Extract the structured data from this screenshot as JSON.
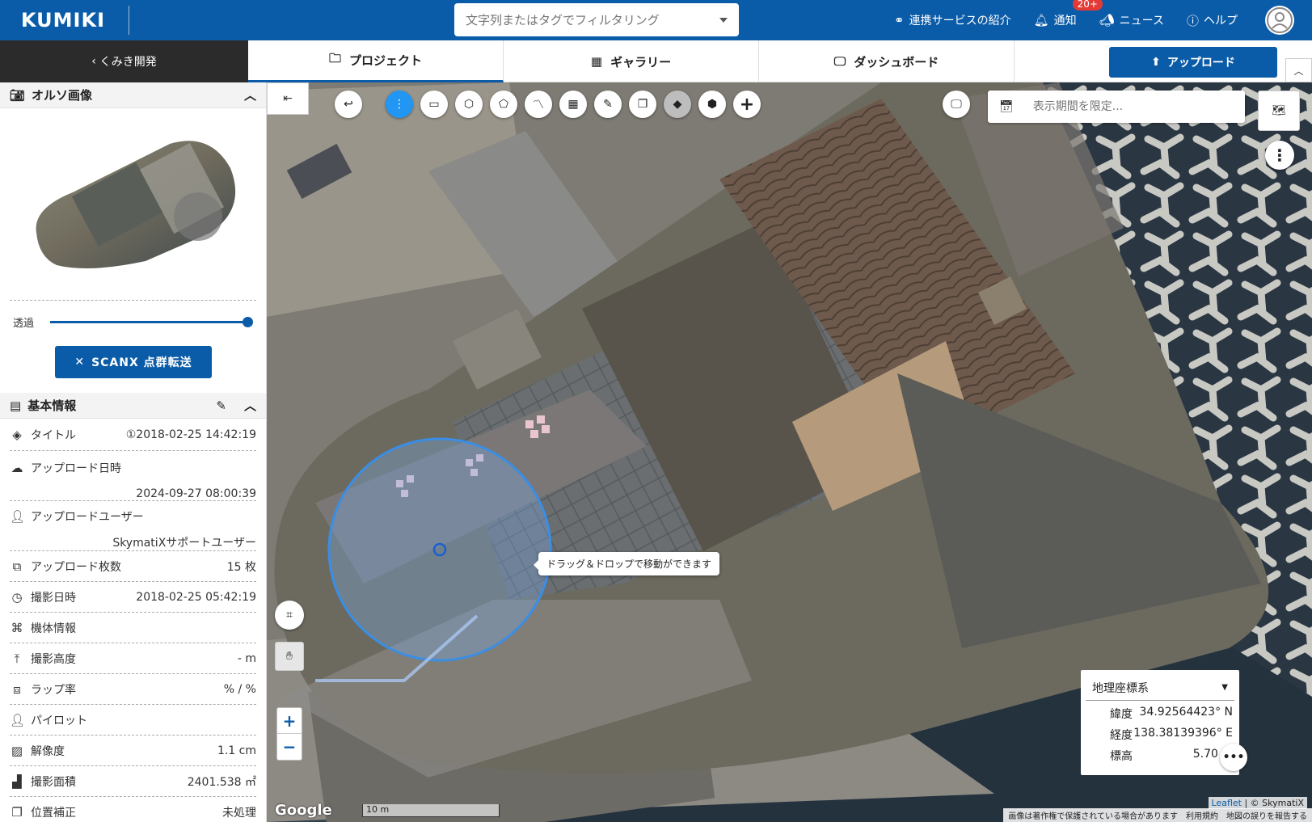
{
  "header": {
    "logo": "KUMIKI",
    "search_placeholder": "文字列またはタグでフィルタリング",
    "links": {
      "services": "連携サービスの紹介",
      "notifications": "通知",
      "notification_badge": "20+",
      "news": "ニュース",
      "help": "ヘルプ"
    }
  },
  "nav": {
    "back_label": "くみき開発",
    "tabs": [
      "プロジェクト",
      "ギャラリー",
      "ダッシュボード"
    ],
    "upload_label": "アップロード"
  },
  "panel": {
    "ortho_title": "オルソ画像",
    "opacity_label": "透過",
    "opacity_value": 1.0,
    "scanx_label": "SCANX 点群転送",
    "info_title": "基本情報",
    "rows": {
      "title": {
        "label": "タイトル",
        "value": "①2018-02-25 14:42:19"
      },
      "upload_date": {
        "label": "アップロード日時",
        "value": "2024-09-27 08:00:39"
      },
      "upload_user": {
        "label": "アップロードユーザー",
        "value": "SkymatiXサポートユーザー"
      },
      "upload_count": {
        "label": "アップロード枚数",
        "value": "15 枚"
      },
      "shoot_date": {
        "label": "撮影日時",
        "value": "2018-02-25 05:42:19"
      },
      "aircraft": {
        "label": "機体情報",
        "value": ""
      },
      "altitude": {
        "label": "撮影高度",
        "value": "- m"
      },
      "overlap": {
        "label": "ラップ率",
        "value": "% / %"
      },
      "pilot": {
        "label": "パイロット",
        "value": ""
      },
      "resolution": {
        "label": "解像度",
        "value": "1.1 cm"
      },
      "area": {
        "label": "撮影面積",
        "value": "2401.538 ㎡"
      },
      "correction": {
        "label": "位置補正",
        "value": "未処理"
      }
    }
  },
  "map": {
    "date_placeholder": "表示期間を限定...",
    "tooltip": "ドラッグ＆ドロップで移動ができます",
    "coords": {
      "system": "地理座標系",
      "lat_label": "緯度",
      "lat_value": "34.92564423° N",
      "lon_label": "経度",
      "lon_value": "138.38139396° E",
      "alt_label": "標高",
      "alt_value": "5.70 m"
    },
    "scale_label": "10 m",
    "google_label": "Google",
    "attribution_leaflet": "Leaflet",
    "attribution_rest": "| © SkymatiX",
    "footer": [
      "画像は著作権で保護されている場合があります",
      "利用規約",
      "地図の誤りを報告する"
    ],
    "tools": [
      "undo-icon",
      "more-vertical-icon",
      "ruler-icon",
      "polygon-area-icon",
      "pentagon-icon",
      "line-chart-icon",
      "grid-icon",
      "edit-icon",
      "copy-icon",
      "eraser-icon",
      "cube-icon",
      "plus-icon"
    ]
  }
}
